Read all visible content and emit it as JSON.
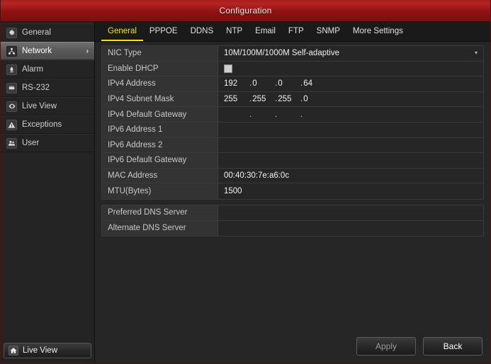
{
  "window": {
    "title": "Configuration"
  },
  "sidebar": {
    "items": [
      {
        "label": "General",
        "icon": "gear-icon",
        "active": false,
        "chevron": ""
      },
      {
        "label": "Network",
        "icon": "network-icon",
        "active": true,
        "chevron": "›"
      },
      {
        "label": "Alarm",
        "icon": "alarm-icon",
        "active": false,
        "chevron": ""
      },
      {
        "label": "RS-232",
        "icon": "serial-icon",
        "active": false,
        "chevron": ""
      },
      {
        "label": "Live View",
        "icon": "eye-icon",
        "active": false,
        "chevron": ""
      },
      {
        "label": "Exceptions",
        "icon": "warning-icon",
        "active": false,
        "chevron": ""
      },
      {
        "label": "User",
        "icon": "users-icon",
        "active": false,
        "chevron": ""
      }
    ],
    "live_view_button": {
      "label": "Live View",
      "icon": "home-icon"
    }
  },
  "tabs": [
    {
      "label": "General",
      "active": true
    },
    {
      "label": "PPPOE",
      "active": false
    },
    {
      "label": "DDNS",
      "active": false
    },
    {
      "label": "NTP",
      "active": false
    },
    {
      "label": "Email",
      "active": false
    },
    {
      "label": "FTP",
      "active": false
    },
    {
      "label": "SNMP",
      "active": false
    },
    {
      "label": "More Settings",
      "active": false
    }
  ],
  "form": {
    "nic_type": {
      "label": "NIC Type",
      "value": "10M/100M/1000M Self-adaptive",
      "arrow": "▾"
    },
    "enable_dhcp": {
      "label": "Enable DHCP",
      "checked": false
    },
    "ipv4_address": {
      "label": "IPv4 Address",
      "octets": [
        "192",
        "0",
        "0",
        "64"
      ]
    },
    "ipv4_subnet_mask": {
      "label": "IPv4 Subnet Mask",
      "octets": [
        "255",
        "255",
        "255",
        "0"
      ]
    },
    "ipv4_default_gateway": {
      "label": "IPv4 Default Gateway",
      "octets": [
        "",
        "",
        "",
        ""
      ]
    },
    "ipv6_address_1": {
      "label": "IPv6 Address 1",
      "value": ""
    },
    "ipv6_address_2": {
      "label": "IPv6 Address 2",
      "value": ""
    },
    "ipv6_default_gateway": {
      "label": "IPv6 Default Gateway",
      "value": ""
    },
    "mac_address": {
      "label": "MAC Address",
      "value": "00:40:30:7e:a6:0c"
    },
    "mtu": {
      "label": "MTU(Bytes)",
      "value": "1500"
    },
    "preferred_dns": {
      "label": "Preferred DNS Server",
      "value": ""
    },
    "alternate_dns": {
      "label": "Alternate DNS Server",
      "value": ""
    }
  },
  "footer": {
    "apply_label": "Apply",
    "back_label": "Back"
  },
  "colors": {
    "title_bar_red": "#a81c1c",
    "active_tab_yellow": "#ffe400",
    "panel_bg": "#262626",
    "label_bg": "#333333"
  }
}
